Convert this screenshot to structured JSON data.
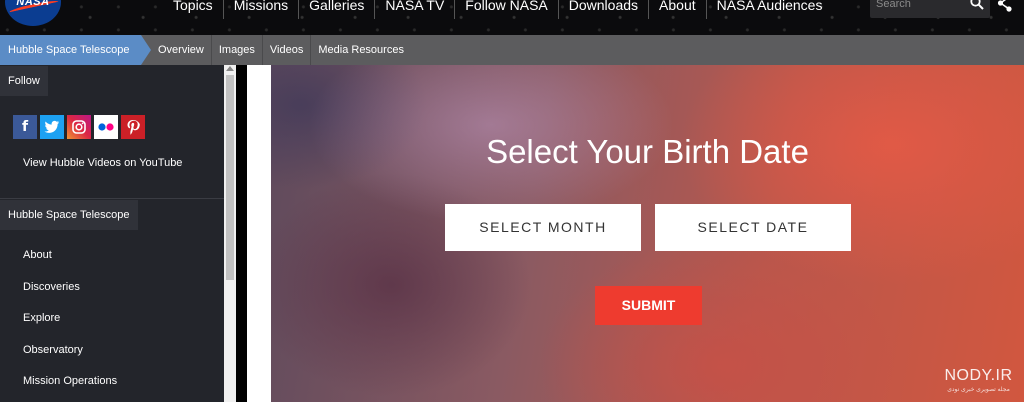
{
  "header": {
    "logo_text": "NASA",
    "nav_items": [
      "Topics",
      "Missions",
      "Galleries",
      "NASA TV",
      "Follow NASA",
      "Downloads",
      "About",
      "NASA Audiences"
    ],
    "search_placeholder": "Search"
  },
  "subnav": {
    "breadcrumb": "Hubble Space Telescope",
    "links": [
      "Overview",
      "Images",
      "Videos",
      "Media Resources"
    ]
  },
  "sidebar": {
    "follow_label": "Follow",
    "social_icons": [
      "facebook-icon",
      "twitter-icon",
      "instagram-icon",
      "flickr-icon",
      "pinterest-icon"
    ],
    "youtube_link": "View Hubble Videos on YouTube",
    "section_label": "Hubble Space Telescope",
    "items": [
      "About",
      "Discoveries",
      "Explore",
      "Observatory",
      "Mission Operations"
    ]
  },
  "hero": {
    "title": "Select Your Birth Date",
    "month_button": "SELECT MONTH",
    "date_button": "SELECT DATE",
    "submit_button": "SUBMIT"
  },
  "watermark": {
    "text": "NODY.IR",
    "subtext": "مجله تصویری خبری نودی"
  },
  "colors": {
    "nasa_blue": "#0b3d91",
    "breadcrumb_blue": "#5b8cc6",
    "submit_red": "#ee3b2f",
    "sidebar_bg": "#23252b"
  }
}
